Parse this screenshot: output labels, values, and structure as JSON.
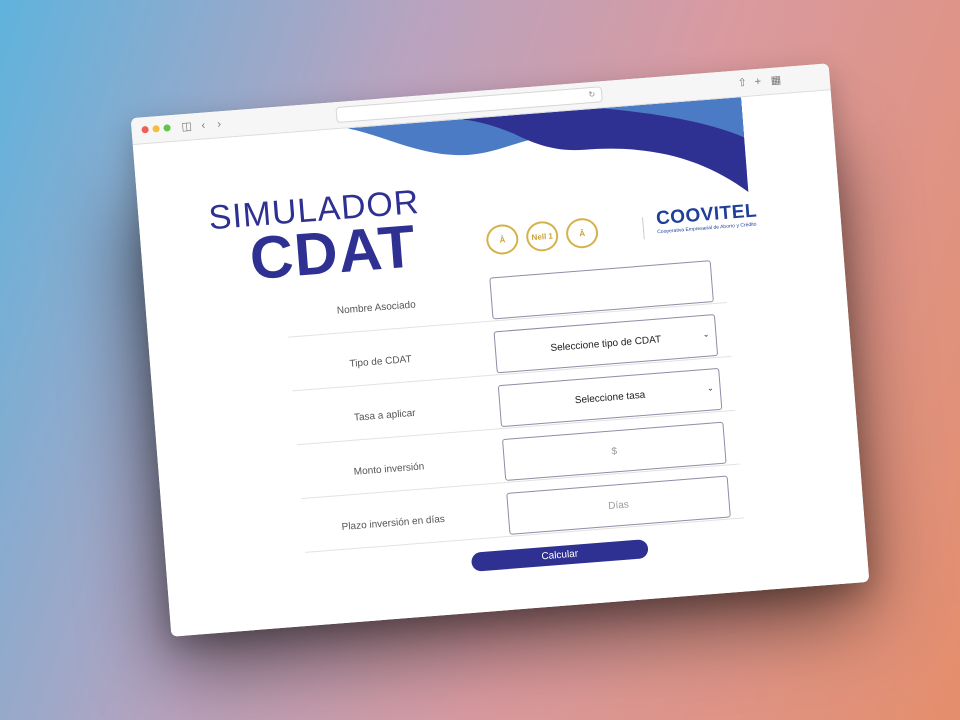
{
  "colors": {
    "primary": "#2e3192",
    "accent_blue": "#4a7bc4",
    "gold": "#d4b24a",
    "logo_blue": "#1f3f98"
  },
  "header": {
    "title_line1": "SIMULADOR",
    "title_line2": "CDAT"
  },
  "badges": [
    "Â",
    "Nell 1",
    "Â"
  ],
  "logo": {
    "name": "COOVITEL",
    "tagline": "Cooperativa Empresarial de Ahorro y Crédito"
  },
  "form": {
    "nombre": {
      "label": "Nombre Asociado",
      "value": "",
      "placeholder": ""
    },
    "tipo": {
      "label": "Tipo de CDAT",
      "selected": "Seleccione tipo de CDAT"
    },
    "tasa": {
      "label": "Tasa a aplicar",
      "selected": "Seleccione tasa"
    },
    "monto": {
      "label": "Monto inversión",
      "value": "",
      "placeholder": "$"
    },
    "plazo": {
      "label": "Plazo inversión en días",
      "value": "",
      "placeholder": "Días"
    }
  },
  "actions": {
    "calcular_label": "Calcular"
  }
}
